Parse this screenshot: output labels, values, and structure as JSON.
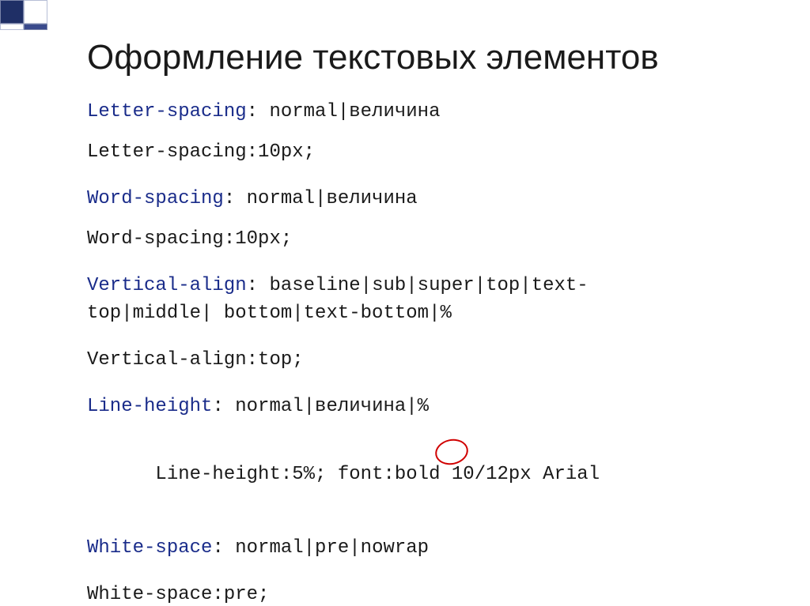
{
  "title": "Оформление текстовых элементов",
  "lines": {
    "l1_prop": "Letter-spacing",
    "l1_rest": ": normal|величина",
    "l2": "Letter-spacing:10px;",
    "l3_prop": "Word-spacing",
    "l3_rest": ": normal|величина",
    "l4": "Word-spacing:10px;",
    "l5_prop": "Vertical-align",
    "l5_rest": ": baseline|sub|super|top|text-",
    "l5b": "top|middle| bottom|text-bottom|%",
    "l6": "Vertical-align:top;",
    "l7_prop": "Line-height",
    "l7_rest": ": normal|величина|%",
    "l8": "Line-height:5%; font:bold 10/12px Arial",
    "l9_prop": "White-space",
    "l9_rest": ": normal|pre|nowrap",
    "l10": "White-space:pre;"
  }
}
